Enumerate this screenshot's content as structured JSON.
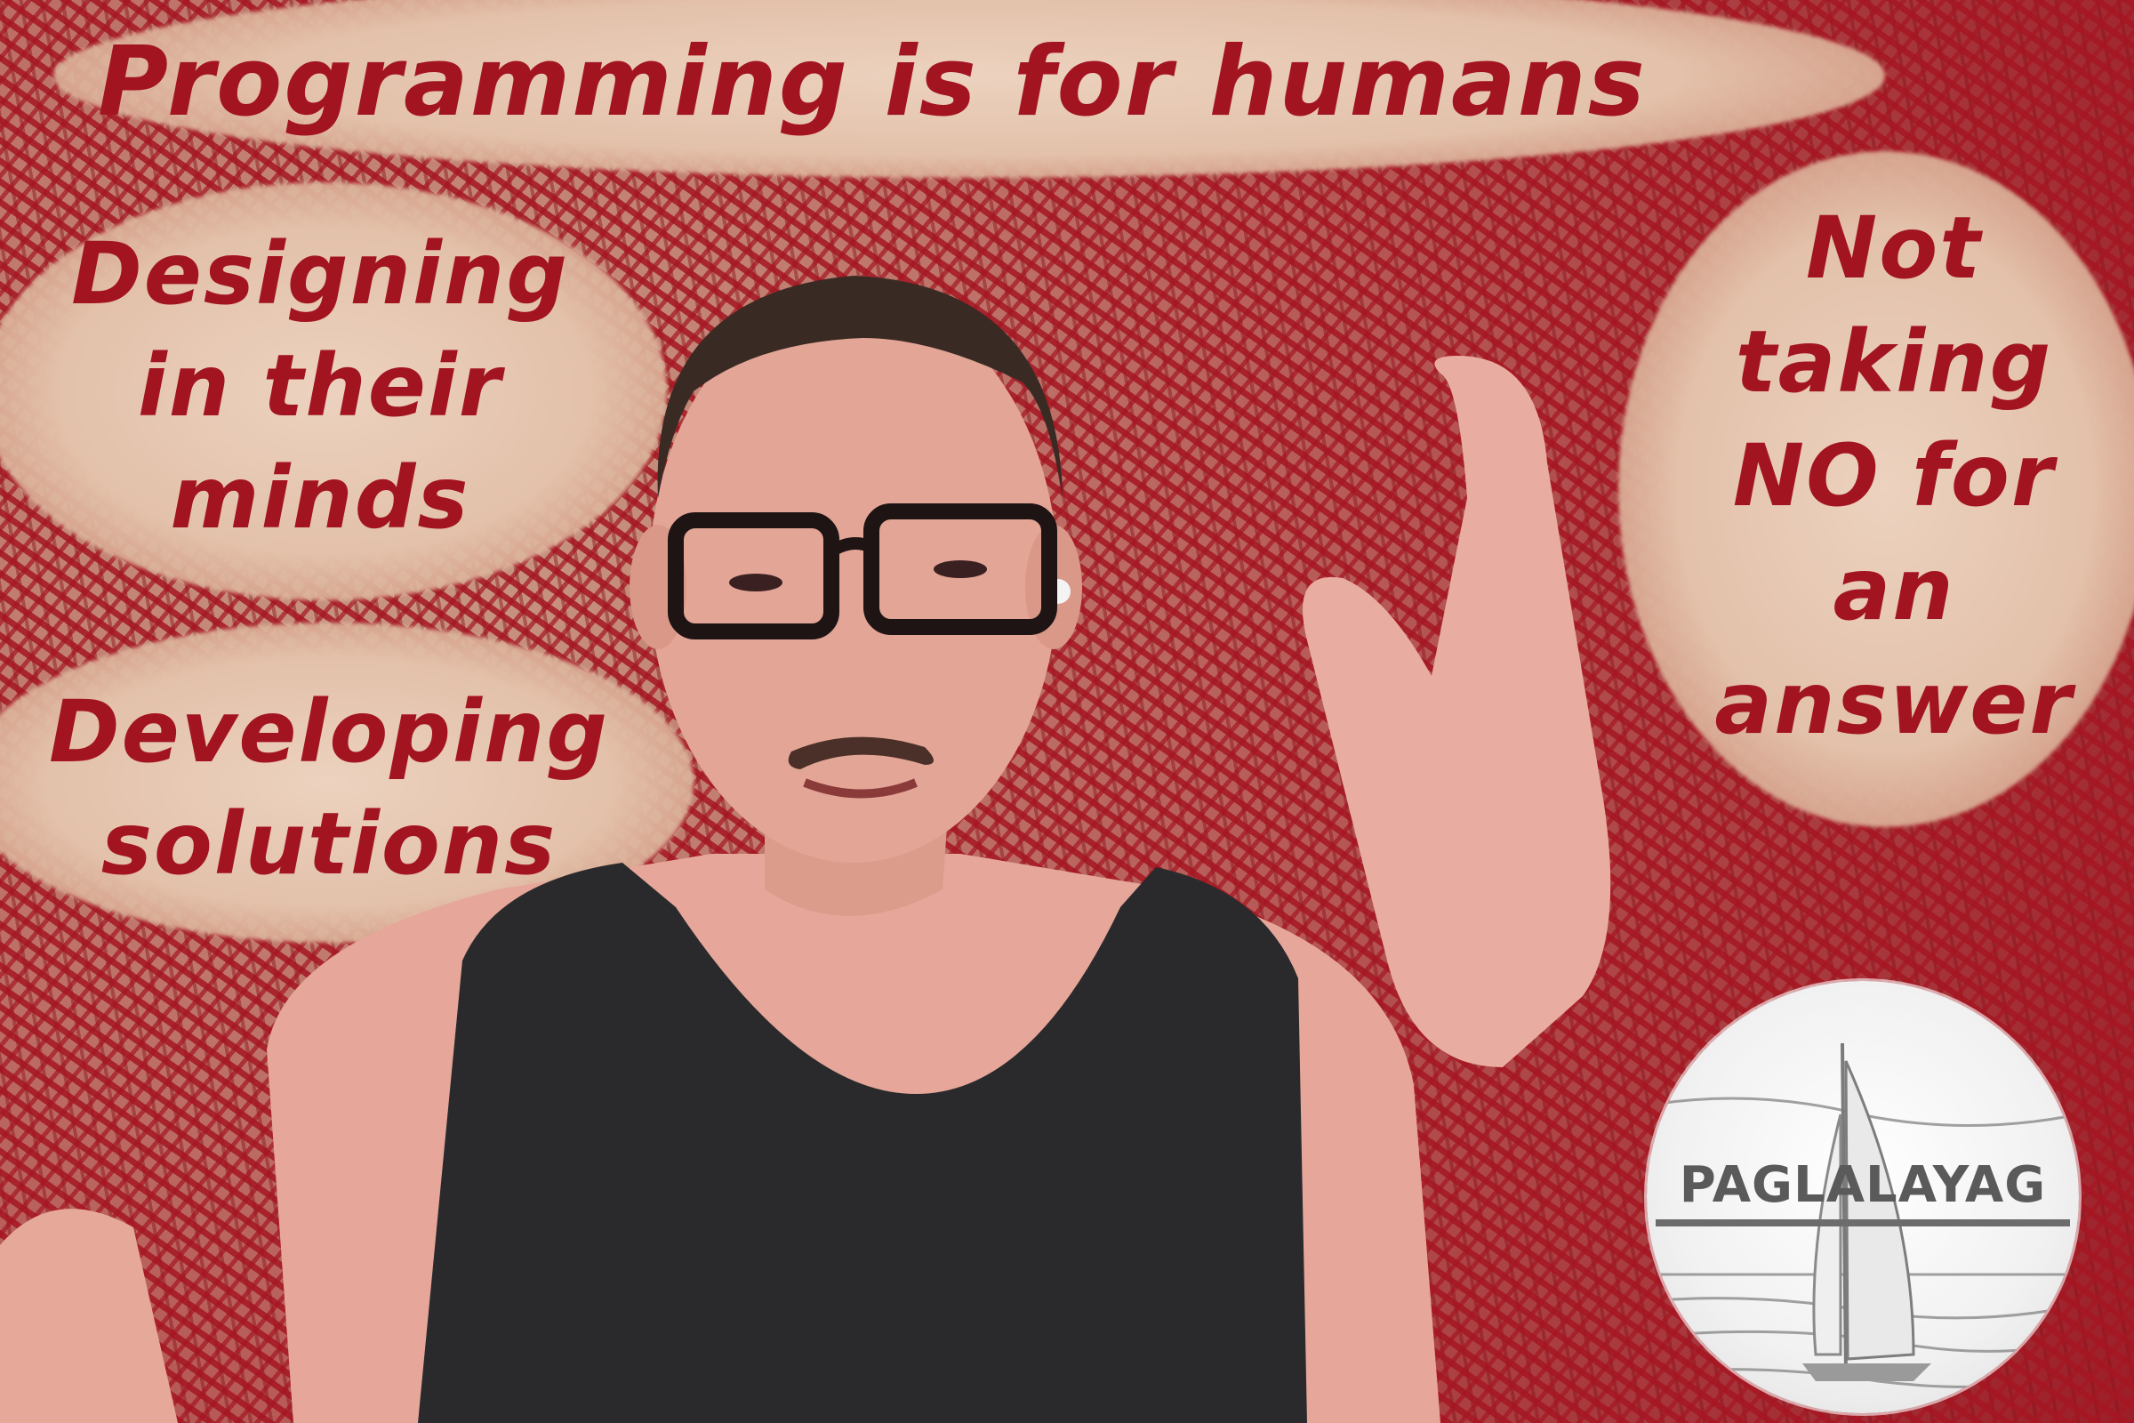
{
  "captions": {
    "title": "Programming is for humans",
    "left_top": [
      "Designing",
      "in their",
      "minds"
    ],
    "left_bottom": [
      "Developing",
      "solutions"
    ],
    "right": [
      "Not",
      "taking",
      "NO for",
      "an",
      "answer"
    ]
  },
  "logo": {
    "text": "PAGLALAYAG"
  },
  "colors": {
    "caption_red": "#a31421",
    "cloud": "#e8cab5",
    "pattern_red": "#a51622"
  }
}
